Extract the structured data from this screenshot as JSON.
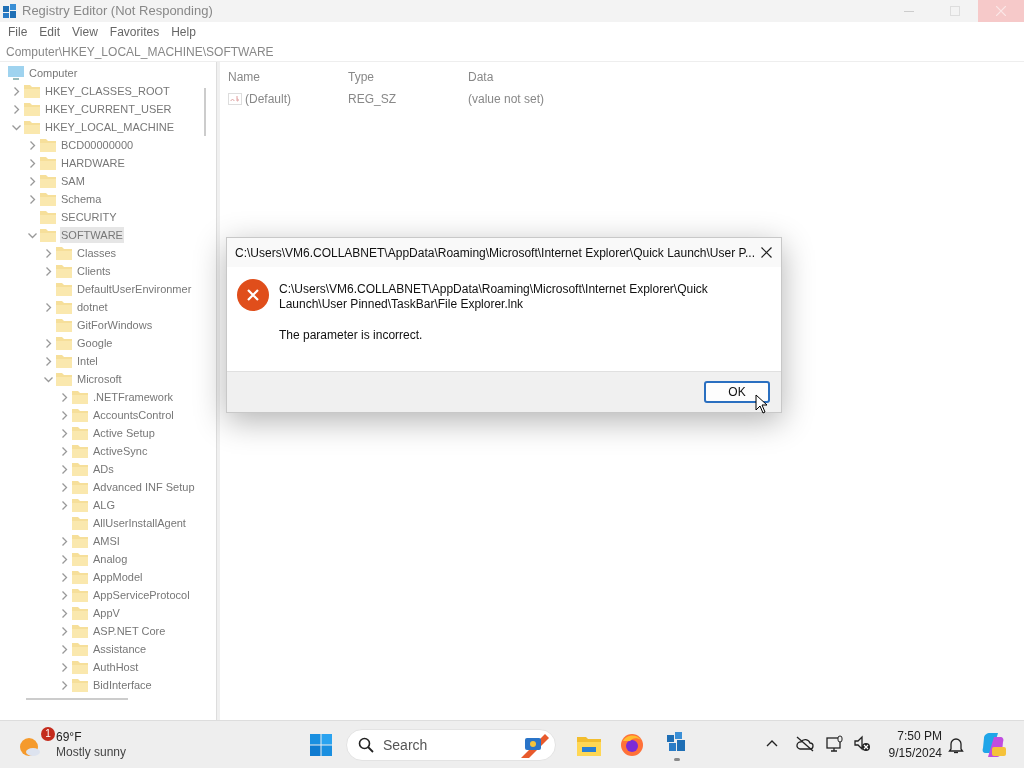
{
  "window": {
    "title": "Registry Editor (Not Responding)"
  },
  "menu": [
    "File",
    "Edit",
    "View",
    "Favorites",
    "Help"
  ],
  "address": "Computer\\HKEY_LOCAL_MACHINE\\SOFTWARE",
  "tree": [
    {
      "label": "Computer",
      "kind": "computer",
      "selected": false,
      "children": [
        {
          "label": "HKEY_CLASSES_ROOT",
          "kind": "branch",
          "expanded": false,
          "selected": false
        },
        {
          "label": "HKEY_CURRENT_USER",
          "kind": "branch",
          "expanded": false,
          "selected": false
        },
        {
          "label": "HKEY_LOCAL_MACHINE",
          "kind": "branch",
          "expanded": true,
          "selected": false,
          "children": [
            {
              "label": "BCD00000000",
              "kind": "branch",
              "expanded": false,
              "selected": false
            },
            {
              "label": "HARDWARE",
              "kind": "branch",
              "expanded": false,
              "selected": false
            },
            {
              "label": "SAM",
              "kind": "branch",
              "expanded": false,
              "selected": false
            },
            {
              "label": "Schema",
              "kind": "branch",
              "expanded": false,
              "selected": false
            },
            {
              "label": "SECURITY",
              "kind": "leaf",
              "selected": false
            },
            {
              "label": "SOFTWARE",
              "kind": "branch",
              "expanded": true,
              "selected": true,
              "children": [
                {
                  "label": "Classes",
                  "kind": "branch",
                  "expanded": false,
                  "selected": false
                },
                {
                  "label": "Clients",
                  "kind": "branch",
                  "expanded": false,
                  "selected": false
                },
                {
                  "label": "DefaultUserEnvironmer",
                  "kind": "leaf",
                  "selected": false
                },
                {
                  "label": "dotnet",
                  "kind": "branch",
                  "expanded": false,
                  "selected": false
                },
                {
                  "label": "GitForWindows",
                  "kind": "leaf",
                  "selected": false
                },
                {
                  "label": "Google",
                  "kind": "branch",
                  "expanded": false,
                  "selected": false
                },
                {
                  "label": "Intel",
                  "kind": "branch",
                  "expanded": false,
                  "selected": false
                },
                {
                  "label": "Microsoft",
                  "kind": "branch",
                  "expanded": true,
                  "selected": false,
                  "children": [
                    {
                      "label": ".NETFramework",
                      "kind": "branch",
                      "expanded": false,
                      "selected": false
                    },
                    {
                      "label": "AccountsControl",
                      "kind": "branch",
                      "expanded": false,
                      "selected": false
                    },
                    {
                      "label": "Active Setup",
                      "kind": "branch",
                      "expanded": false,
                      "selected": false
                    },
                    {
                      "label": "ActiveSync",
                      "kind": "branch",
                      "expanded": false,
                      "selected": false
                    },
                    {
                      "label": "ADs",
                      "kind": "branch",
                      "expanded": false,
                      "selected": false
                    },
                    {
                      "label": "Advanced INF Setup",
                      "kind": "branch",
                      "expanded": false,
                      "selected": false
                    },
                    {
                      "label": "ALG",
                      "kind": "branch",
                      "expanded": false,
                      "selected": false
                    },
                    {
                      "label": "AllUserInstallAgent",
                      "kind": "leaf",
                      "selected": false
                    },
                    {
                      "label": "AMSI",
                      "kind": "branch",
                      "expanded": false,
                      "selected": false
                    },
                    {
                      "label": "Analog",
                      "kind": "branch",
                      "expanded": false,
                      "selected": false
                    },
                    {
                      "label": "AppModel",
                      "kind": "branch",
                      "expanded": false,
                      "selected": false
                    },
                    {
                      "label": "AppServiceProtocol",
                      "kind": "branch",
                      "expanded": false,
                      "selected": false
                    },
                    {
                      "label": "AppV",
                      "kind": "branch",
                      "expanded": false,
                      "selected": false
                    },
                    {
                      "label": "ASP.NET Core",
                      "kind": "branch",
                      "expanded": false,
                      "selected": false
                    },
                    {
                      "label": "Assistance",
                      "kind": "branch",
                      "expanded": false,
                      "selected": false
                    },
                    {
                      "label": "AuthHost",
                      "kind": "branch",
                      "expanded": false,
                      "selected": false
                    },
                    {
                      "label": "BidInterface",
                      "kind": "branch",
                      "expanded": false,
                      "selected": false
                    }
                  ]
                }
              ]
            }
          ]
        }
      ]
    }
  ],
  "values": {
    "columns": [
      "Name",
      "Type",
      "Data"
    ],
    "rows": [
      {
        "name": "(Default)",
        "type": "REG_SZ",
        "data": "(value not set)"
      }
    ]
  },
  "dialog": {
    "title": "C:\\Users\\VM6.COLLABNET\\AppData\\Roaming\\Microsoft\\Internet Explorer\\Quick Launch\\User P...",
    "message": "C:\\Users\\VM6.COLLABNET\\AppData\\Roaming\\Microsoft\\Internet Explorer\\Quick Launch\\User Pinned\\TaskBar\\File Explorer.lnk",
    "detail": "The parameter is incorrect.",
    "buttons": [
      "OK"
    ]
  },
  "taskbar": {
    "weather": {
      "badge": "1",
      "temperature": "69°F",
      "condition": "Mostly sunny"
    },
    "search": {
      "placeholder": "Search"
    },
    "clock": {
      "time": "7:50 PM",
      "date": "9/15/2024"
    }
  }
}
